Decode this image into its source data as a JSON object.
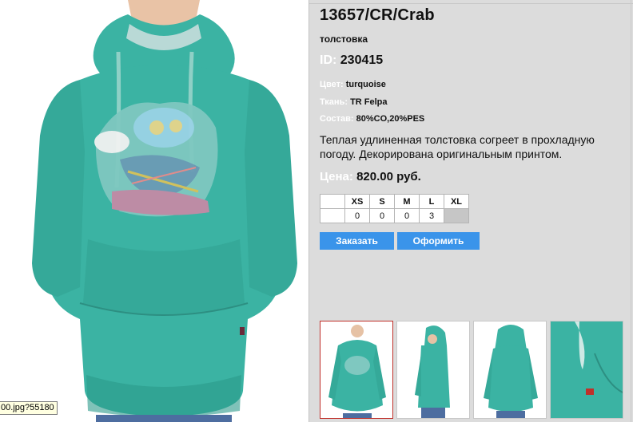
{
  "image_tooltip": "00.jpg?55180",
  "product": {
    "title": "13657/CR/Crab",
    "type": "толстовка",
    "id_label": "ID:",
    "id_value": "230415",
    "color_label": "Цвет:",
    "color_value": "turquoise",
    "fabric_label": "Ткань:",
    "fabric_value": "TR Felpa",
    "composition_label": "Состав:",
    "composition_value": "80%CO,20%PES",
    "description": "Теплая удлиненная толстовка согреет в прохладную погоду. Декорирована оригинальным принтом.",
    "price_label": "Цена:",
    "price_value": "820.00 руб."
  },
  "sizes": {
    "headers": [
      "XS",
      "S",
      "M",
      "L",
      "XL"
    ],
    "quantities": [
      "0",
      "0",
      "0",
      "3",
      ""
    ]
  },
  "buttons": {
    "order": "Заказать",
    "checkout": "Оформить"
  },
  "thumbnails": [
    {
      "view": "front",
      "selected": true
    },
    {
      "view": "side",
      "selected": false
    },
    {
      "view": "back",
      "selected": false
    },
    {
      "view": "detail",
      "selected": false
    }
  ],
  "colors": {
    "garment": "#3bb3a3",
    "button": "#3a94ea",
    "selected_border": "#c0302a"
  }
}
